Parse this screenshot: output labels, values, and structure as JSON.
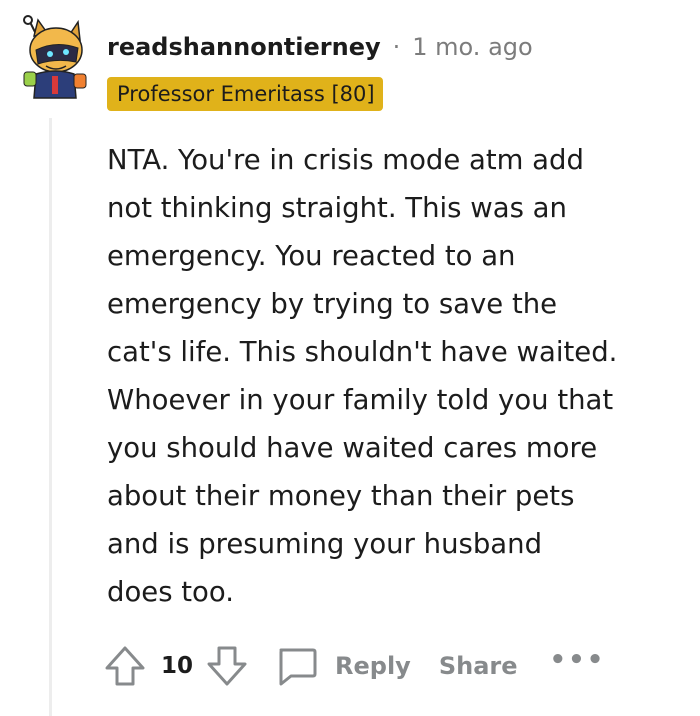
{
  "comment": {
    "username": "readshannontierney",
    "separator": "·",
    "time": "1 mo. ago",
    "flair": "Professor Emeritass [80]",
    "body": "NTA. You're in crisis mode atm add\nnot thinking straight. This was an\nemergency. You reacted to an\nemergency by trying to save the\ncat's life. This shouldn't have waited.\nWhoever in your family told you that\nyou should have waited cares more\nabout their money than their pets\nand is presuming your husband\ndoes too."
  },
  "actions": {
    "score": "10",
    "reply_label": "Reply",
    "share_label": "Share",
    "more_label": "•••"
  },
  "colors": {
    "flair_bg": "#e0b21a",
    "muted": "#878a8c",
    "text": "#1c1c1c"
  },
  "icons": [
    "avatar",
    "upvote-icon",
    "downvote-icon",
    "comment-bubble-icon",
    "more-icon"
  ]
}
